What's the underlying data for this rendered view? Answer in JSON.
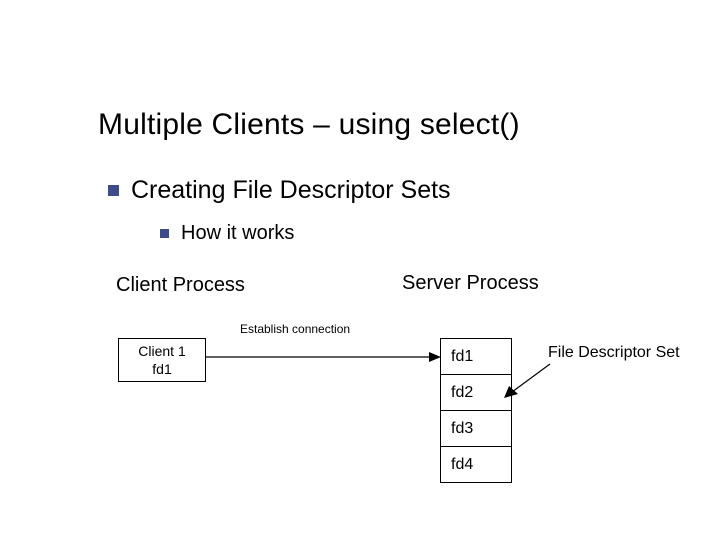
{
  "title": "Multiple Clients – using select()",
  "bullets": {
    "level1": "Creating File Descriptor Sets",
    "level2": "How it works"
  },
  "labels": {
    "client_process": "Client Process",
    "server_process": "Server Process",
    "establish_connection": "Establish connection",
    "fd_set": "File Descriptor Set"
  },
  "client_box": {
    "name": "Client 1",
    "fd": "fd1"
  },
  "fd_cells": {
    "c1": "fd1",
    "c2": "fd2",
    "c3": "fd3",
    "c4": "fd4"
  }
}
